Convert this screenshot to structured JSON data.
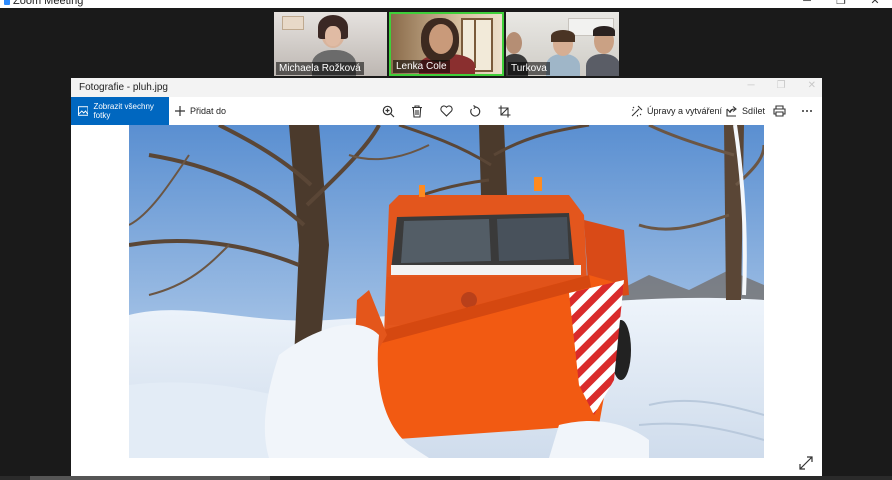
{
  "zoom": {
    "title": "Zoom Meeting",
    "window_controls": [
      "─",
      "❐",
      "✕"
    ]
  },
  "participants": [
    {
      "name": "Michaela Rožková"
    },
    {
      "name": "Lenka Cole"
    },
    {
      "name": "Turkova"
    }
  ],
  "photos": {
    "title": "Fotografie - pluh.jpg",
    "toolbar": {
      "view_all_label": "Zobrazit všechny fotky",
      "add_to_label": "Přidat do",
      "edit_create_label": "Úpravy a vytváření",
      "share_label": "Sdílet"
    },
    "icons": {
      "zoom": "zoom-in-icon",
      "delete": "trash-icon",
      "favorite": "heart-icon",
      "rotate": "rotate-icon",
      "crop": "crop-icon",
      "edit": "edit-create-icon",
      "share": "share-icon",
      "print": "print-icon",
      "more": "more-icon",
      "expand": "expand-icon"
    },
    "colors": {
      "accent": "#0067c0",
      "active_speaker": "#3fcf3a"
    }
  }
}
